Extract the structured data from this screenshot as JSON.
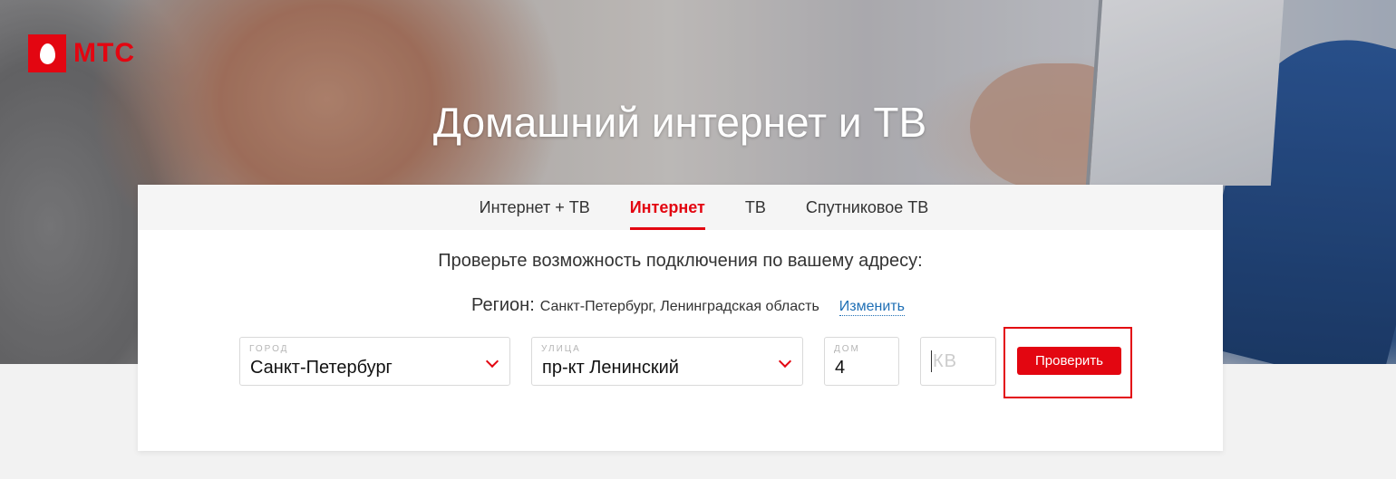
{
  "header": {
    "brand": "МТС",
    "title": "Домашний интернет и ТВ"
  },
  "tabs": [
    {
      "label": "Интернет + ТВ",
      "active": false
    },
    {
      "label": "Интернет",
      "active": true
    },
    {
      "label": "ТВ",
      "active": false
    },
    {
      "label": "Спутниковое ТВ",
      "active": false
    }
  ],
  "form": {
    "prompt": "Проверьте возможность подключения по вашему адресу:",
    "region_label": "Регион:",
    "region_value": "Санкт-Петербург, Ленинградская область",
    "change_link": "Изменить",
    "city": {
      "caption": "ГОРОД",
      "value": "Санкт-Петербург"
    },
    "street": {
      "caption": "УЛИЦА",
      "value": "пр-кт Ленинский"
    },
    "house": {
      "caption": "ДОМ",
      "value": "4"
    },
    "apartment": {
      "placeholder": "КВ"
    },
    "submit_label": "Проверить"
  },
  "colors": {
    "accent": "#e30611",
    "link": "#1f6fb5"
  }
}
